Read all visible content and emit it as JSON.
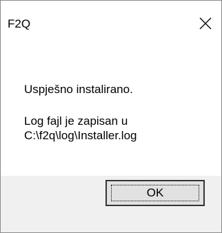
{
  "window": {
    "title": "F2Q",
    "close_icon": "close-icon"
  },
  "message": {
    "line1": "Uspješno instalirano.",
    "line2": "Log fajl je zapisan u",
    "line3": "C:\\f2q\\log\\Installer.log"
  },
  "buttons": {
    "ok_label": "OK"
  },
  "colors": {
    "footer_background": "#f0f0f0",
    "button_background": "#e1e1e1",
    "button_border": "#333333",
    "window_border": "#8a8a8a"
  }
}
